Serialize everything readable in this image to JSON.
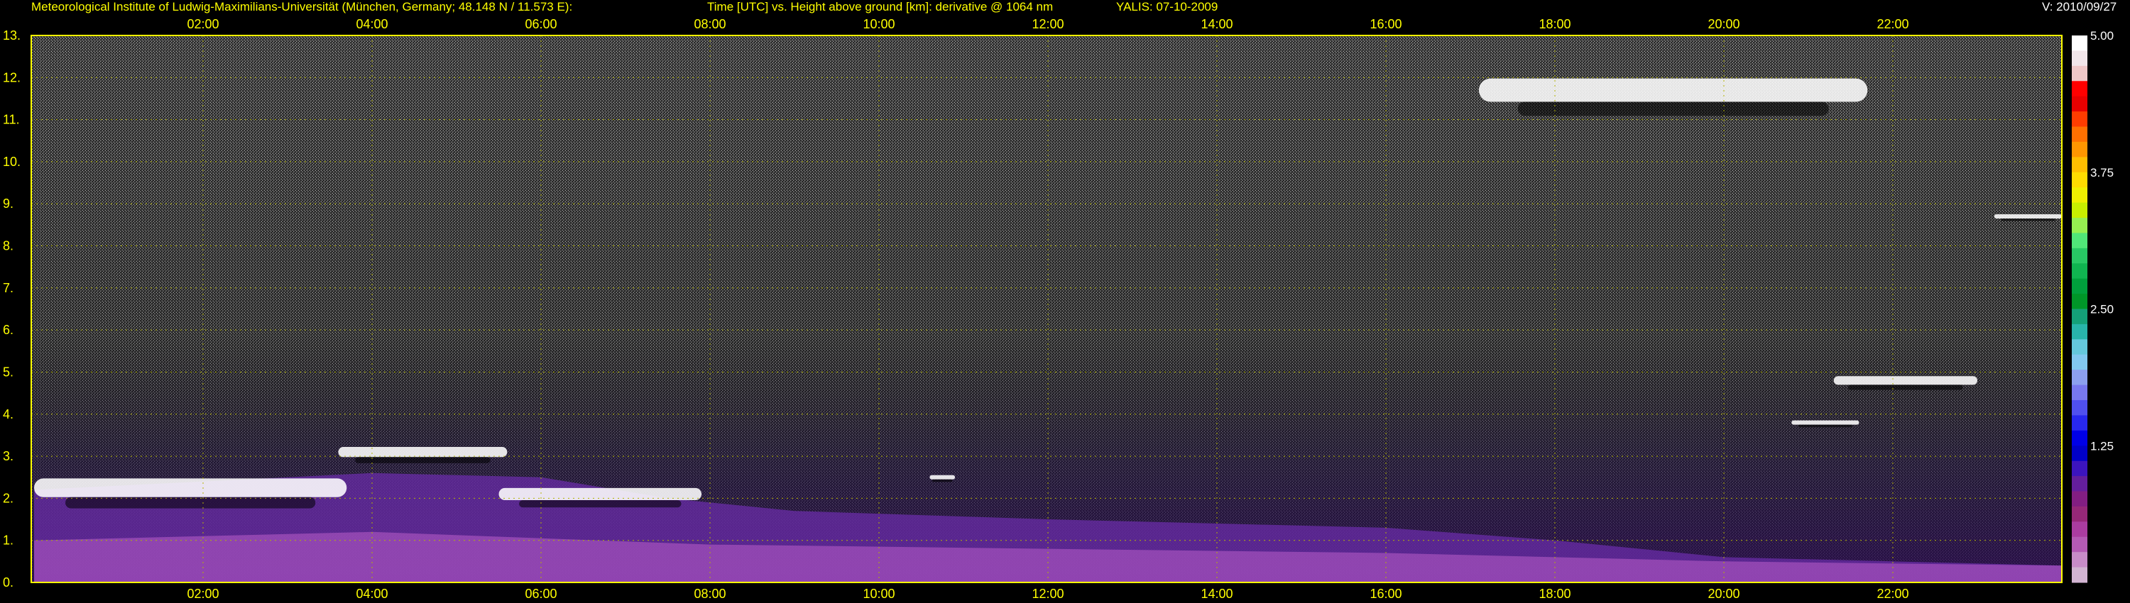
{
  "header": {
    "institute": "Meteorological Institute of Ludwig-Maximilians-Universität (München, Germany; 48.148 N / 11.573 E):",
    "description": "Time [UTC] vs. Height above ground [km]: derivative @ 1064 nm",
    "instrument": "YALIS: 07-10-2009",
    "version": "V: 2010/09/27"
  },
  "colors": {
    "text": "#ffff00",
    "version_text": "#ffffff",
    "frame": "#ffff00",
    "grid": "#b4b400",
    "background": "#000000",
    "noise": "#8a8a8a",
    "aerosol": "#6a2ca8",
    "boundary_layer": "#d06ad6",
    "cloud": "#ffffff"
  },
  "colorbar": {
    "labels": [
      "5.00",
      "3.75",
      "2.50",
      "1.25"
    ],
    "colors": [
      "#ffffff",
      "#f2e6ea",
      "#f0c8c8",
      "#ff0000",
      "#e80000",
      "#ff3c00",
      "#ff7000",
      "#ff9600",
      "#ffbe00",
      "#ffdc00",
      "#f0f000",
      "#c8f000",
      "#96f050",
      "#50e678",
      "#28c864",
      "#10b450",
      "#00a03c",
      "#009628",
      "#14a078",
      "#28b4aa",
      "#64c8dc",
      "#82c8f0",
      "#8ca0f0",
      "#7878f0",
      "#5050f0",
      "#2828f0",
      "#0000e6",
      "#0000c8",
      "#3c14be",
      "#641e9c",
      "#821e82",
      "#962878",
      "#aa3ca0",
      "#b45ab4",
      "#c88cc8",
      "#d2b4d2"
    ]
  },
  "chart_data": {
    "type": "heatmap",
    "title": "Time [UTC] vs. Height above ground [km]: derivative @ 1064 nm",
    "xlabel": "Time [UTC]",
    "ylabel": "Height above ground [km]",
    "x_ticks": [
      "02:00",
      "04:00",
      "06:00",
      "08:00",
      "10:00",
      "12:00",
      "14:00",
      "16:00",
      "18:00",
      "20:00",
      "22:00"
    ],
    "x_tick_hours": [
      2,
      4,
      6,
      8,
      10,
      12,
      14,
      16,
      18,
      20,
      22
    ],
    "xlim_hours": [
      0,
      24
    ],
    "y_ticks": [
      "0.",
      "1.",
      "2.",
      "3.",
      "4.",
      "5.",
      "6.",
      "7.",
      "8.",
      "9.",
      "10.",
      "11.",
      "12.",
      "13."
    ],
    "y_tick_values": [
      0,
      1,
      2,
      3,
      4,
      5,
      6,
      7,
      8,
      9,
      10,
      11,
      12,
      13
    ],
    "ylim_km": [
      0,
      13
    ],
    "colorbar_range": [
      0,
      5
    ],
    "grid": true,
    "features": [
      {
        "type": "aerosol_layer_top",
        "points_hours_km": [
          [
            0,
            2.2
          ],
          [
            2,
            2.4
          ],
          [
            4,
            2.6
          ],
          [
            6,
            2.5
          ],
          [
            7.5,
            2.0
          ],
          [
            9,
            1.7
          ],
          [
            12,
            1.5
          ],
          [
            16,
            1.3
          ],
          [
            18,
            1.0
          ],
          [
            20,
            0.6
          ],
          [
            22,
            0.5
          ],
          [
            24,
            0.4
          ]
        ]
      },
      {
        "type": "cloud",
        "start_h": 0.0,
        "end_h": 3.7,
        "height_km": 2.25
      },
      {
        "type": "cloud",
        "start_h": 3.6,
        "end_h": 5.6,
        "height_km": 3.1
      },
      {
        "type": "cloud",
        "start_h": 5.5,
        "end_h": 7.9,
        "height_km": 2.1
      },
      {
        "type": "cloud",
        "start_h": 10.6,
        "end_h": 10.9,
        "height_km": 2.5
      },
      {
        "type": "cloud",
        "start_h": 17.1,
        "end_h": 21.7,
        "height_km": 11.7
      },
      {
        "type": "cloud",
        "start_h": 21.3,
        "end_h": 23.0,
        "height_km": 4.8
      },
      {
        "type": "cloud",
        "start_h": 20.8,
        "end_h": 21.6,
        "height_km": 3.8
      },
      {
        "type": "cloud",
        "start_h": 23.2,
        "end_h": 24.0,
        "height_km": 8.7
      }
    ]
  }
}
